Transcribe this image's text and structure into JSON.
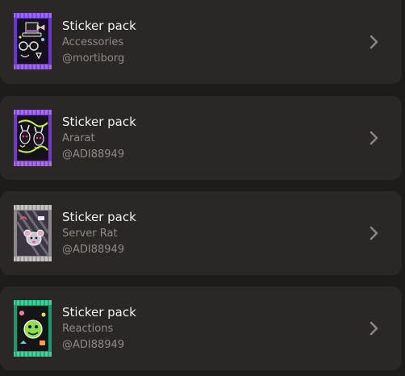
{
  "sticker_packs": [
    {
      "title": "Sticker pack",
      "name": "Accessories",
      "author": "@mortiborg",
      "theme_color": "#7b3fe4",
      "icon": "top-hat-sticker-icon"
    },
    {
      "title": "Sticker pack",
      "name": "Ararat",
      "author": "@ADI88949",
      "theme_color": "#8a3fd8",
      "icon": "bunny-sticker-icon"
    },
    {
      "title": "Sticker pack",
      "name": "Server Rat",
      "author": "@ADI88949",
      "theme_color": "#9a9595",
      "icon": "rat-sticker-icon"
    },
    {
      "title": "Sticker pack",
      "name": "Reactions",
      "author": "@ADI88949",
      "theme_color": "#1fa77a",
      "icon": "reaction-face-sticker-icon"
    }
  ],
  "colors": {
    "background": "#1d1c1b",
    "card": "#2a2827",
    "title_text": "#f3f1ee",
    "secondary_text": "#8f8a85",
    "chevron": "#8a8581"
  },
  "chevron_icon": "chevron-right-icon"
}
